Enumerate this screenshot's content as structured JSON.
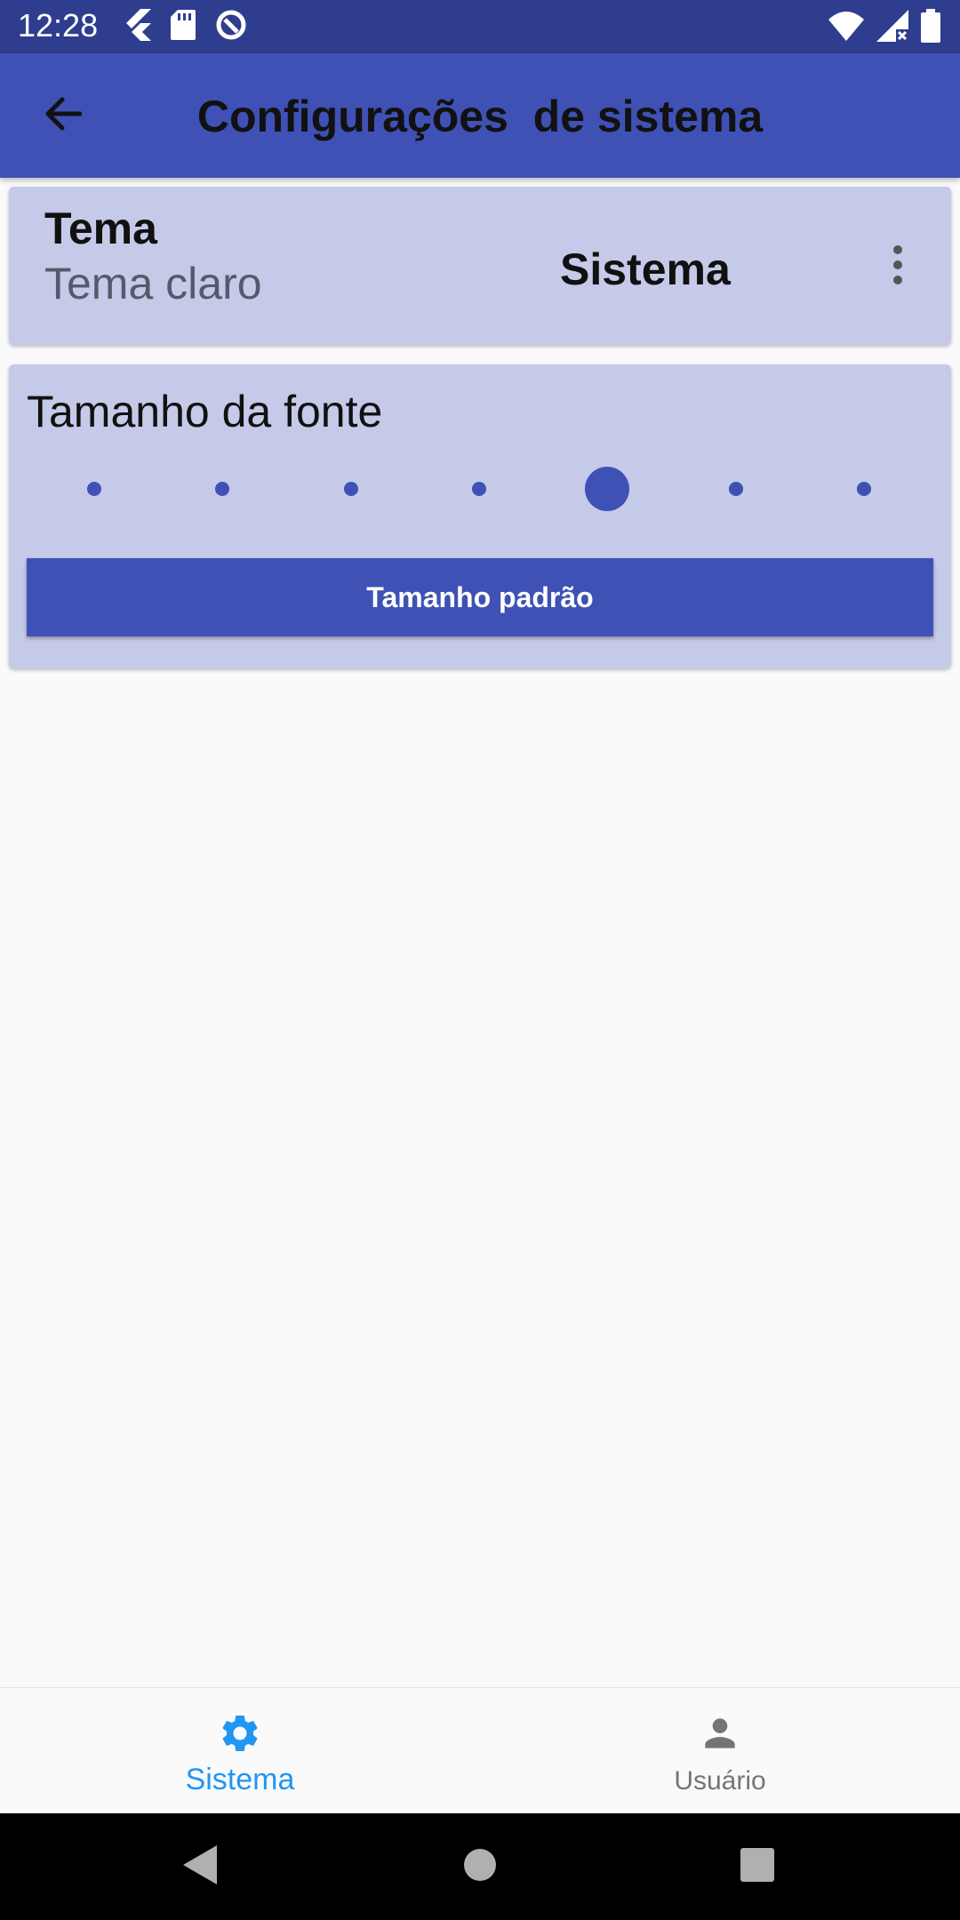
{
  "status_bar": {
    "time": "12:28",
    "left_icons": [
      "flutter-icon",
      "sd-card-icon",
      "no-disturb-icon"
    ],
    "right_icons": [
      "wifi-icon",
      "signal-icon",
      "battery-icon"
    ]
  },
  "app_bar": {
    "title": "Configurações  de sistema",
    "back_icon": "arrow-back-icon",
    "color": "#3f51b5"
  },
  "theme_card": {
    "title": "Tema",
    "subtitle": "Tema claro",
    "value": "Sistema",
    "menu_icon": "more-vert-icon"
  },
  "font_card": {
    "title": "Tamanho da fonte",
    "slider": {
      "steps": 7,
      "selected_index": 4
    },
    "reset_button": "Tamanho padrão"
  },
  "bottom_nav": {
    "items": [
      {
        "label": "Sistema",
        "icon": "gear-icon",
        "active": true
      },
      {
        "label": "Usuário",
        "icon": "person-icon",
        "active": false
      }
    ],
    "active_color": "#2196f3"
  },
  "system_nav": [
    "back-triangle-icon",
    "home-circle-icon",
    "recents-square-icon"
  ]
}
